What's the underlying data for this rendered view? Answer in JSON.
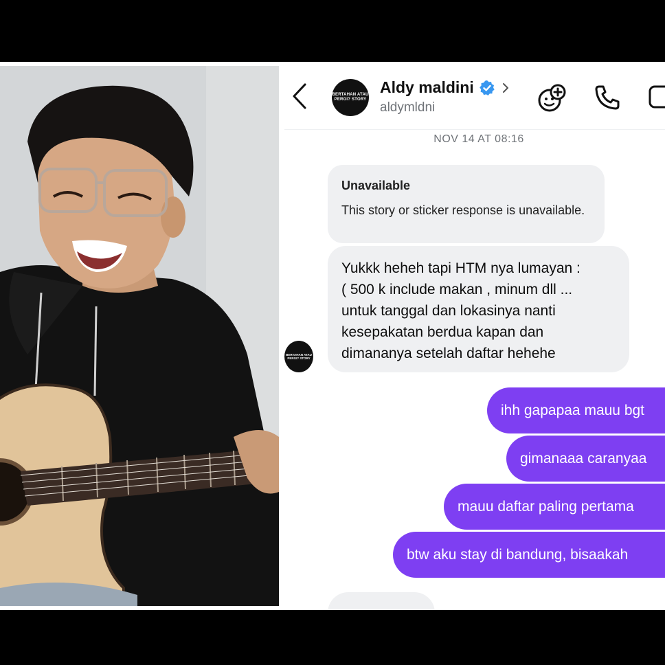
{
  "header": {
    "name": "Aldy maldini",
    "username": "aldymldni",
    "avatar_text": "BERTAHAN ATAU PERGI? STORY"
  },
  "icons": {
    "back": "chevron-left-icon",
    "verified": "verified-badge-icon",
    "chevron": "chevron-right-icon",
    "sticker": "sticker-add-icon",
    "call": "phone-icon",
    "video": "video-icon"
  },
  "colors": {
    "accent": "#7e3ff2",
    "verified": "#3897f0",
    "incoming_bubble": "#eff0f2"
  },
  "chat": {
    "timestamp": "NOV 14 AT 08:16",
    "unavailable_title": "Unavailable",
    "unavailable_body": "This story or sticker response is unavailable.",
    "incoming_lines": [
      "Yukkk heheh tapi HTM nya lumayan :",
      "( 500 k include makan , minum dll ...",
      "untuk tanggal dan lokasinya nanti",
      "kesepakatan berdua kapan dan",
      "dimananya setelah daftar hehehe"
    ],
    "outgoing": [
      "ihh gapapaa mauu bgt",
      "gimanaaa caranyaa",
      "mauu daftar paling pertama",
      "btw aku stay di bandung, bisaakah"
    ]
  }
}
